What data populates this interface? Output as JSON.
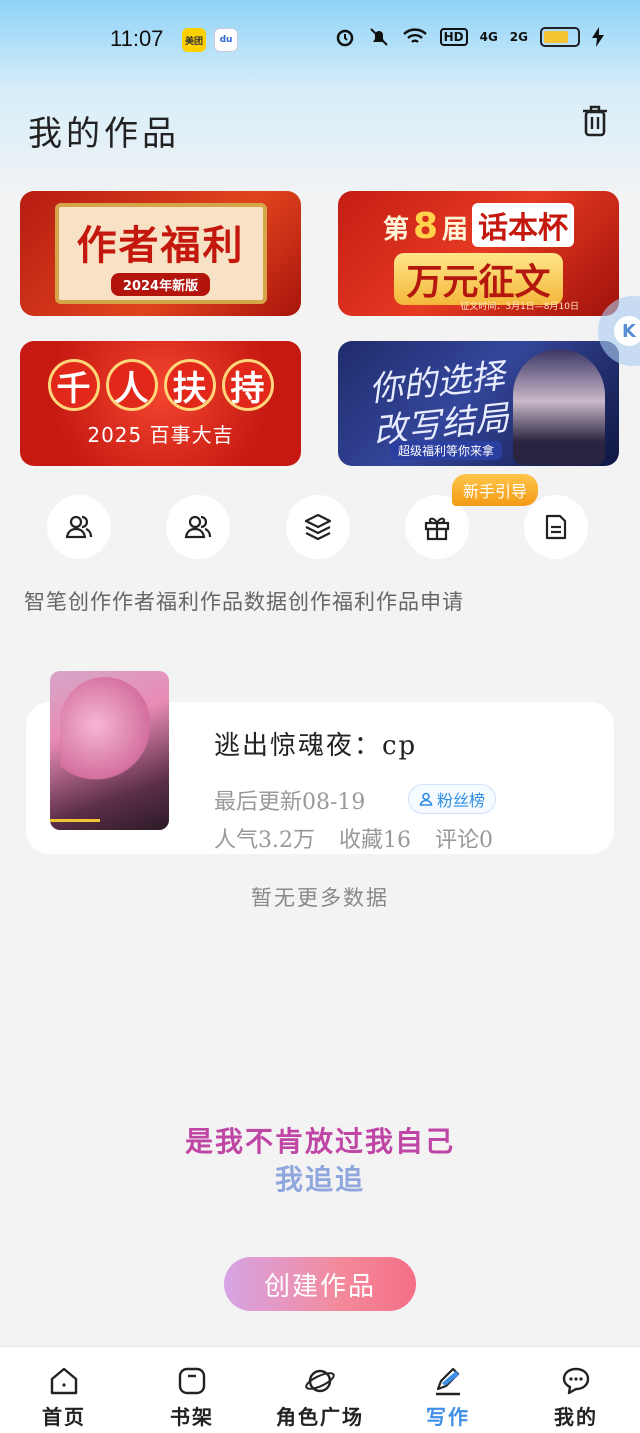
{
  "status_bar": {
    "time": "11:07",
    "app_icon_1": "美团",
    "app_icon_2": "du",
    "hd_label": "HD",
    "sig_1": "4G",
    "sig_2": "2G"
  },
  "header": {
    "title": "我的作品"
  },
  "banners": {
    "welfare": {
      "title": "作者福利",
      "subtitle": "2024年新版"
    },
    "contest": {
      "prefix": "第",
      "number": "8",
      "suffix": "届",
      "cup": "话本杯",
      "main": "万元征文",
      "date": "征文时间：3月1日—8月10日"
    },
    "support": {
      "chars": [
        "千",
        "人",
        "扶",
        "持"
      ],
      "subtitle": "2025 百事大吉"
    },
    "choice": {
      "title_line1": "你的选择",
      "title_line2": "改写结局",
      "subtitle": "超级福利等你来拿"
    }
  },
  "floating_button": {
    "label": "K"
  },
  "quick_actions": {
    "badge": "新手引导",
    "labels": "智笔创作作者福利作品数据创作福利作品申请"
  },
  "work": {
    "title": "逃出惊魂夜：cp",
    "updated": "最后更新08-19",
    "fan_rank": "粉丝榜",
    "popularity": "人气3.2万",
    "favorites": "收藏16",
    "comments": "评论0"
  },
  "empty_hint": "暂无更多数据",
  "slogan": {
    "line1": "是我不肯放过我自己",
    "line2": "我追追"
  },
  "create_button": "创建作品",
  "nav": {
    "home": "首页",
    "bookshelf": "书架",
    "role_square": "角色广场",
    "write": "写作",
    "mine": "我的"
  },
  "colors": {
    "accent": "#3f8ee6",
    "create_gradient_start": "#d7a4e6",
    "create_gradient_end": "#f56e86",
    "slogan_1": "#c046a6",
    "slogan_2": "#8fa7dd"
  }
}
